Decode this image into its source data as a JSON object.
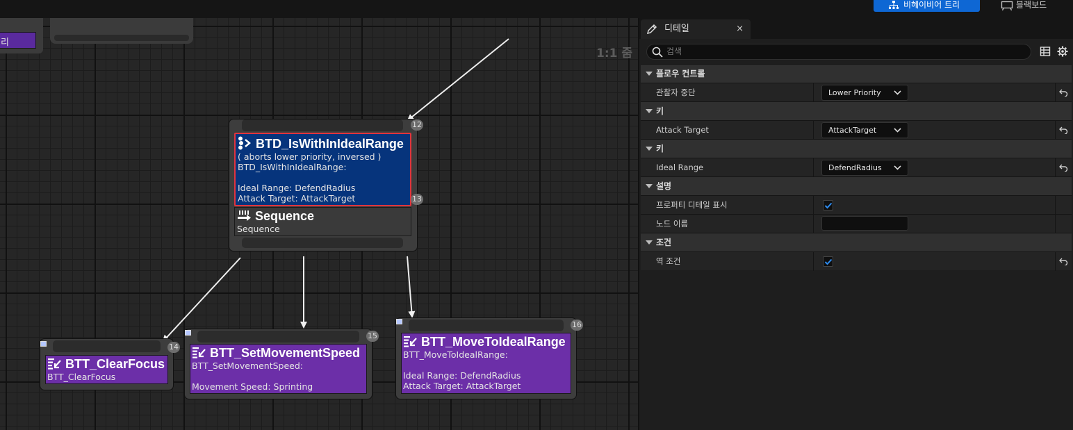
{
  "toolbar": {
    "behavior_tree_label": "비헤이비어 트리",
    "blackboard_label": "블랙보드",
    "colors": {
      "accent": "#0e67d4"
    }
  },
  "graph": {
    "zoom_label": "1:1 줌",
    "partial_left_label": "리",
    "nodes": {
      "decorator": {
        "index": "12",
        "title": "BTD_IsWithInIdealRange",
        "lines": [
          "( aborts lower priority, inversed )",
          "BTD_IsWithInIdealRange:",
          "",
          "Ideal Range: DefendRadius",
          "Attack Target: AttackTarget"
        ],
        "icon": "decorator-icon"
      },
      "sequence": {
        "index": "13",
        "title": "Sequence",
        "subtitle": "Sequence",
        "icon": "sequence-icon"
      },
      "clear_focus": {
        "index": "14",
        "title": "BTT_ClearFocus",
        "lines": [
          "BTT_ClearFocus"
        ],
        "icon": "task-icon"
      },
      "set_movement_speed": {
        "index": "15",
        "title": "BTT_SetMovementSpeed",
        "lines": [
          "BTT_SetMovementSpeed:",
          "",
          "Movement Speed: Sprinting"
        ],
        "icon": "task-icon"
      },
      "move_to_ideal_range": {
        "index": "16",
        "title": "BTT_MoveToIdealRange",
        "lines": [
          "BTT_MoveToIdealRange:",
          "",
          "Ideal Range: DefendRadius",
          "Attack Target: AttackTarget"
        ],
        "icon": "task-icon"
      }
    },
    "colors": {
      "task": "#6c2fa8",
      "decorator": "#06347c",
      "selected_border": "#e0343e"
    }
  },
  "details": {
    "tab_label": "디테일",
    "close_glyph": "×",
    "search_placeholder": "검색",
    "categories": [
      {
        "label": "플로우 컨트롤",
        "props": [
          {
            "name": "관찰자 중단",
            "type": "combo",
            "value": "Lower Priority",
            "reset": true
          }
        ]
      },
      {
        "label": "키",
        "props": [
          {
            "name": "Attack Target",
            "type": "combo",
            "value": "AttackTarget",
            "reset": true
          }
        ]
      },
      {
        "label": "키",
        "props": [
          {
            "name": "Ideal Range",
            "type": "combo",
            "value": "DefendRadius",
            "reset": true
          }
        ]
      },
      {
        "label": "설명",
        "props": [
          {
            "name": "프로퍼티 디테일 표시",
            "type": "check",
            "checked": true,
            "reset": false
          },
          {
            "name": "노드 이름",
            "type": "text",
            "value": "",
            "reset": false
          }
        ]
      },
      {
        "label": "조건",
        "props": [
          {
            "name": "역 조건",
            "type": "check",
            "checked": true,
            "reset": true
          }
        ]
      }
    ]
  }
}
